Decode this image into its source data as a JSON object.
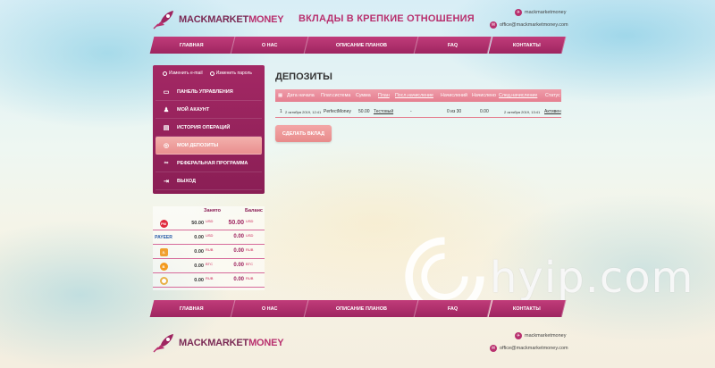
{
  "brand": {
    "logo_part1": "MACK",
    "logo_part2": "MARKET",
    "logo_part3": "MONEY"
  },
  "slogan": "ВКЛАДЫ В КРЕПКИЕ ОТНОШЕНИЯ",
  "contacts": {
    "telegram": "mackmarketmoney",
    "email": "office@mackmarketmoney.com"
  },
  "nav": [
    "ГЛАВНАЯ",
    "О НАС",
    "ОПИСАНИЕ ПЛАНОВ",
    "FAQ",
    "КОНТАКТЫ"
  ],
  "sidebar": {
    "change_email": "Изменить e-mail",
    "change_password": "Изменить пароль",
    "items": [
      {
        "label": "ПАНЕЛЬ УПРАВЛЕНИЯ",
        "icon": "folder-icon"
      },
      {
        "label": "МОЙ АКАУНТ",
        "icon": "user-icon"
      },
      {
        "label": "ИСТОРИЯ ОПЕРАЦИЙ",
        "icon": "history-icon"
      },
      {
        "label": "МОИ ДЕПОЗИТЫ",
        "icon": "coins-icon",
        "active": true
      },
      {
        "label": "РЕФЕРАЛЬНАЯ ПРОГРАММА",
        "icon": "link-icon"
      },
      {
        "label": "ВЫХОД",
        "icon": "exit-icon"
      }
    ]
  },
  "balance": {
    "col_invested": "Занято",
    "col_balance": "Баланс",
    "rows": [
      {
        "system": "PM",
        "invested": "50.00",
        "inv_cur": "USD",
        "balance": "50.00",
        "bal_cur": "USD"
      },
      {
        "system": "PAYEER",
        "invested": "0.00",
        "inv_cur": "USD",
        "balance": "0.00",
        "bal_cur": "USD"
      },
      {
        "system": "fire",
        "invested": "0.00",
        "inv_cur": "RUB",
        "balance": "0.00",
        "bal_cur": "RUB"
      },
      {
        "system": "B",
        "invested": "0.00",
        "inv_cur": "BTC",
        "balance": "0.00",
        "bal_cur": "BTC"
      },
      {
        "system": "adv",
        "invested": "0.00",
        "inv_cur": "RUB",
        "balance": "0.00",
        "bal_cur": "RUB"
      }
    ]
  },
  "main": {
    "title": "ДЕПОЗИТЫ",
    "columns": [
      "Дата начала",
      "Плат.система",
      "Сумма",
      "План",
      "Посл.начисление",
      "Начислений",
      "Начислено",
      "След.начисление",
      "Статус"
    ],
    "row": {
      "num": "1",
      "start": "2 октября 2019, 12:41",
      "system": "PerfectMoney",
      "amount": "50.00",
      "plan": "Тестовый",
      "last": "-",
      "count": "0 из 30",
      "accrued": "0.00",
      "next": "2 октября 2019, 13:41",
      "status": "Активен"
    },
    "make_deposit": "СДЕЛАТЬ ВКЛАД"
  },
  "watermark": "hyip.com"
}
